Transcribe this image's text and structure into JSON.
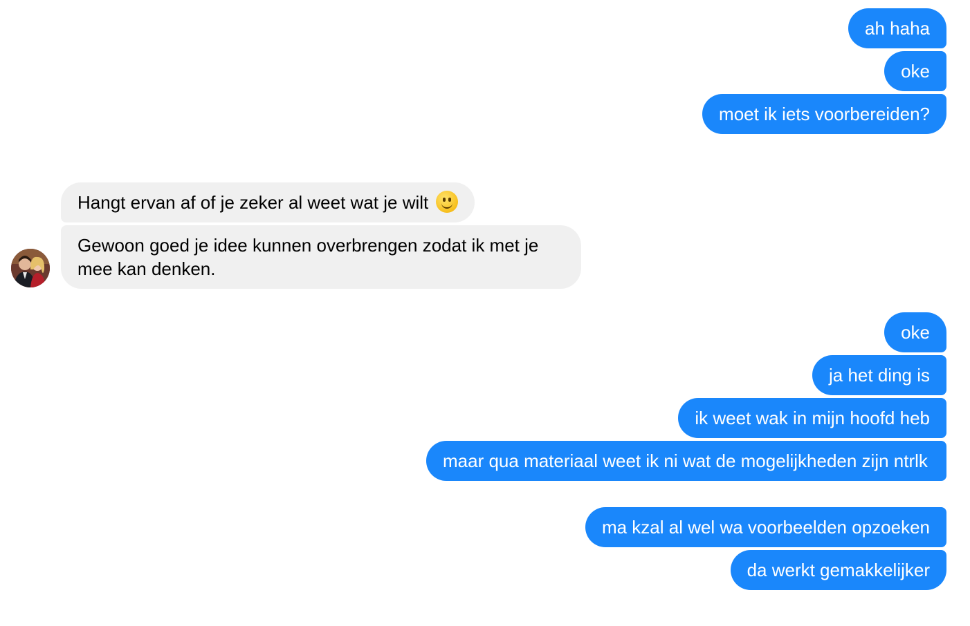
{
  "conversation": {
    "group1": [
      {
        "text": "ah haha"
      },
      {
        "text": "oke"
      },
      {
        "text": "moet ik iets voorbereiden?"
      }
    ],
    "incoming": [
      {
        "text": "Hangt ervan af of je zeker al weet wat je wilt",
        "emoji": "slightly-smiling-face"
      },
      {
        "text": "Gewoon goed je idee kunnen overbrengen zodat ik met je mee kan denken."
      }
    ],
    "group2": [
      {
        "text": "oke"
      },
      {
        "text": "ja het ding is"
      },
      {
        "text": "ik weet wak in mijn hoofd heb"
      },
      {
        "text": "maar qua materiaal weet ik ni wat de mogelijkheden zijn ntrlk"
      },
      {
        "text": "ma kzal al wel wa voorbeelden opzoeken"
      },
      {
        "text": "da werkt gemakkelijker"
      }
    ]
  },
  "colors": {
    "outgoing_bubble": "#1a87fb",
    "incoming_bubble": "#f0f0f0"
  }
}
